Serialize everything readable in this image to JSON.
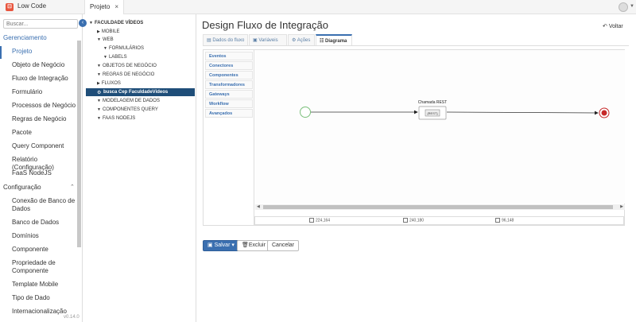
{
  "app": {
    "title": "Low Code",
    "logo_glyph": "⊡",
    "version": "v0.14.0"
  },
  "tab": {
    "label": "Projeto",
    "close": "×"
  },
  "search": {
    "placeholder": "Buscar..."
  },
  "sidebar": {
    "sections": [
      {
        "label": "Gerenciamento",
        "caret": "‹",
        "active": true
      },
      {
        "label": "Configuração",
        "caret": "⌃",
        "active": false
      }
    ],
    "management_items": [
      "Projeto",
      "Objeto de Negócio",
      "Fluxo de Integração",
      "Formulário",
      "Processos de Negócio",
      "Regras de Negócio",
      "Pacote",
      "Query Component",
      "Relatório (Configuração)",
      "FaaS NodeJS"
    ],
    "config_items": [
      "Conexão de Banco de Dados",
      "Banco de Dados",
      "Domínios",
      "Componente",
      "Propriedade de Componente",
      "Template Mobile",
      "Tipo de Dado",
      "Internacionalização"
    ]
  },
  "tree": {
    "root": "FACULDADE VÍDEOS",
    "nodes": [
      "MOBILE",
      "WEB",
      "FORMULÁRIOS",
      "LABELS",
      "OBJETOS DE NEGÓCIO",
      "REGRAS DE NEGÓCIO",
      "FLUXOS",
      "busca Cep FaculdadeVideos",
      "MODELAGEM DE DADOS",
      "COMPONENTES QUERY",
      "FAAS NODEJS"
    ]
  },
  "main": {
    "title": "Design Fluxo de Integração",
    "back": "Voltar",
    "tabs": [
      {
        "label": "Dados do fluxo",
        "active": false
      },
      {
        "label": "Variáveis",
        "active": false
      },
      {
        "label": "Ações",
        "active": false
      },
      {
        "label": "Diagrama",
        "active": true
      }
    ]
  },
  "palette": [
    "Eventos",
    "Conectores",
    "Componentes",
    "Transformadores",
    "Gateways",
    "Workflow",
    "Avançados"
  ],
  "diagram": {
    "node_label": "Chamada REST",
    "node_badge": "{REST}"
  },
  "status": {
    "pos1": "224,164",
    "pos2": "240,180",
    "size": "96,148"
  },
  "buttons": {
    "save": "Salvar",
    "delete": "Excluir",
    "cancel": "Cancelar"
  },
  "colors": {
    "accent": "#3a6fb0",
    "tree_selected": "#1f4e79",
    "start_event": "#7cc07c",
    "end_event": "#c62828"
  }
}
